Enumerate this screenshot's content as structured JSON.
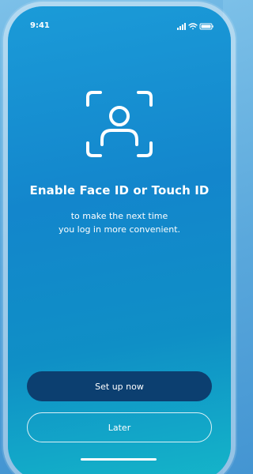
{
  "status_bar": {
    "time": "9:41",
    "icons": [
      "signal-icon",
      "wifi-icon",
      "battery-icon"
    ]
  },
  "hero": {
    "icon": "face-id-icon",
    "title": "Enable Face ID or Touch ID",
    "subtitle_line1": "to make the next time",
    "subtitle_line2": "you log in more convenient."
  },
  "actions": {
    "primary_label": "Set up now",
    "secondary_label": "Later"
  },
  "colors": {
    "gradient_top": "#1b9bd8",
    "gradient_bottom": "#14b5c9",
    "primary_button": "#0c3f70",
    "text": "#ffffff"
  }
}
